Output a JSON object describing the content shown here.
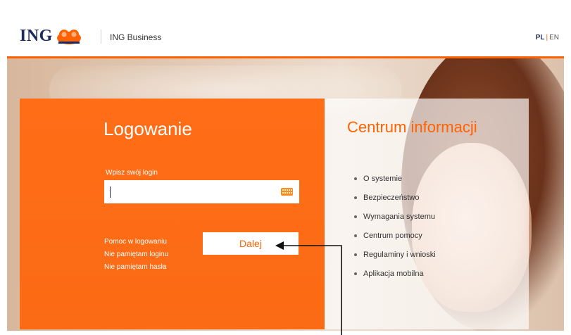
{
  "header": {
    "logo_text": "ING",
    "product_name": "ING Business",
    "lang_active": "PL",
    "lang_separator": "|",
    "lang_other": "EN"
  },
  "login": {
    "title": "Logowanie",
    "login_label": "Wpisz swój login",
    "login_value": "",
    "help_links": [
      "Pomoc w logowaniu",
      "Nie pamiętam loginu",
      "Nie pamiętam hasła"
    ],
    "submit_label": "Dalej"
  },
  "info": {
    "title": "Centrum informacji",
    "items": [
      "O systemie",
      "Bezpieczeństwo",
      "Wymagania systemu",
      "Centrum pomocy",
      "Regulaminy i wnioski",
      "Aplikacja mobilna"
    ]
  },
  "icons": {
    "keyboard": "keyboard-icon",
    "logo": "lion-logo-icon"
  },
  "colors": {
    "brand_orange": "#ff6200",
    "panel_orange": "#ff6d17",
    "brand_navy": "#1f2a63",
    "annotation": "#111111"
  }
}
